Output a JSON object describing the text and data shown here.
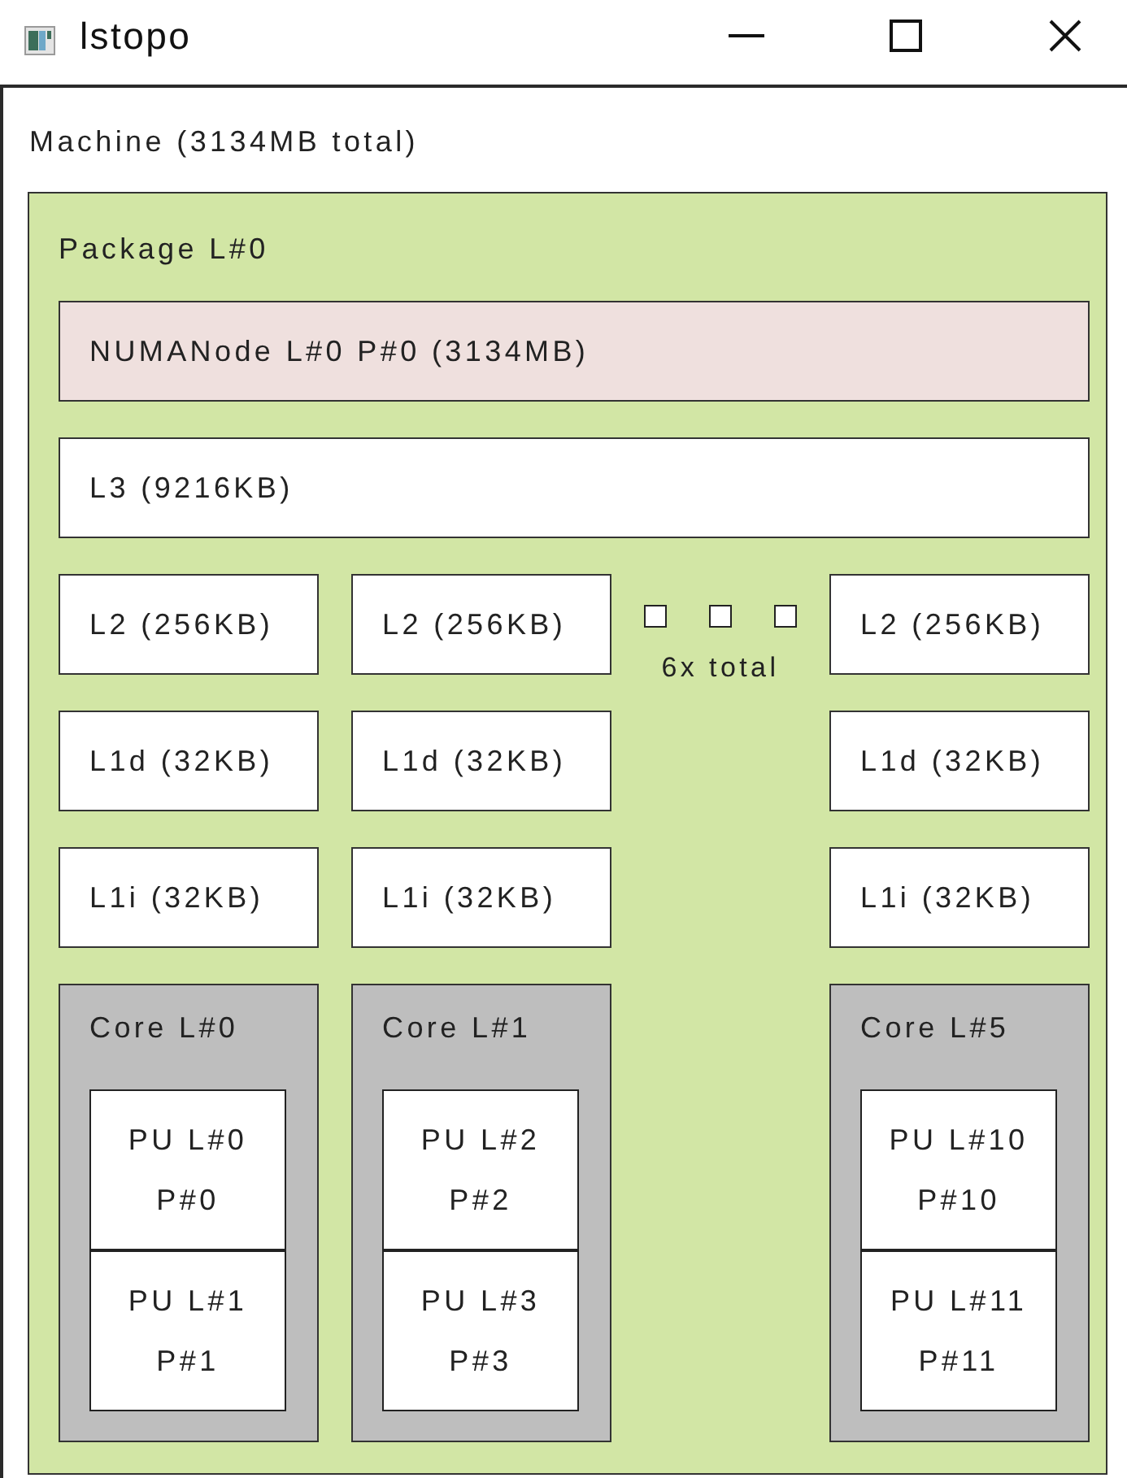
{
  "window": {
    "title": "lstopo"
  },
  "machine": {
    "label": "Machine (3134MB total)",
    "package": {
      "label": "Package L#0",
      "numa_node": "NUMANode L#0 P#0 (3134MB)",
      "l3": "L3 (9216KB)",
      "columns": [
        {
          "kind": "core",
          "l2": "L2 (256KB)",
          "l1d": "L1d (32KB)",
          "l1i": "L1i (32KB)",
          "core": {
            "label": "Core L#0",
            "pus": [
              {
                "label": "PU L#0",
                "physical": "P#0"
              },
              {
                "label": "PU L#1",
                "physical": "P#1"
              }
            ]
          }
        },
        {
          "kind": "core",
          "l2": "L2 (256KB)",
          "l1d": "L1d (32KB)",
          "l1i": "L1i (32KB)",
          "core": {
            "label": "Core L#1",
            "pus": [
              {
                "label": "PU L#2",
                "physical": "P#2"
              },
              {
                "label": "PU L#3",
                "physical": "P#3"
              }
            ]
          }
        },
        {
          "kind": "collapsed",
          "label": "6x total"
        },
        {
          "kind": "core",
          "l2": "L2 (256KB)",
          "l1d": "L1d (32KB)",
          "l1i": "L1i (32KB)",
          "core": {
            "label": "Core L#5",
            "pus": [
              {
                "label": "PU L#10",
                "physical": "P#10"
              },
              {
                "label": "PU L#11",
                "physical": "P#11"
              }
            ]
          }
        }
      ]
    }
  }
}
